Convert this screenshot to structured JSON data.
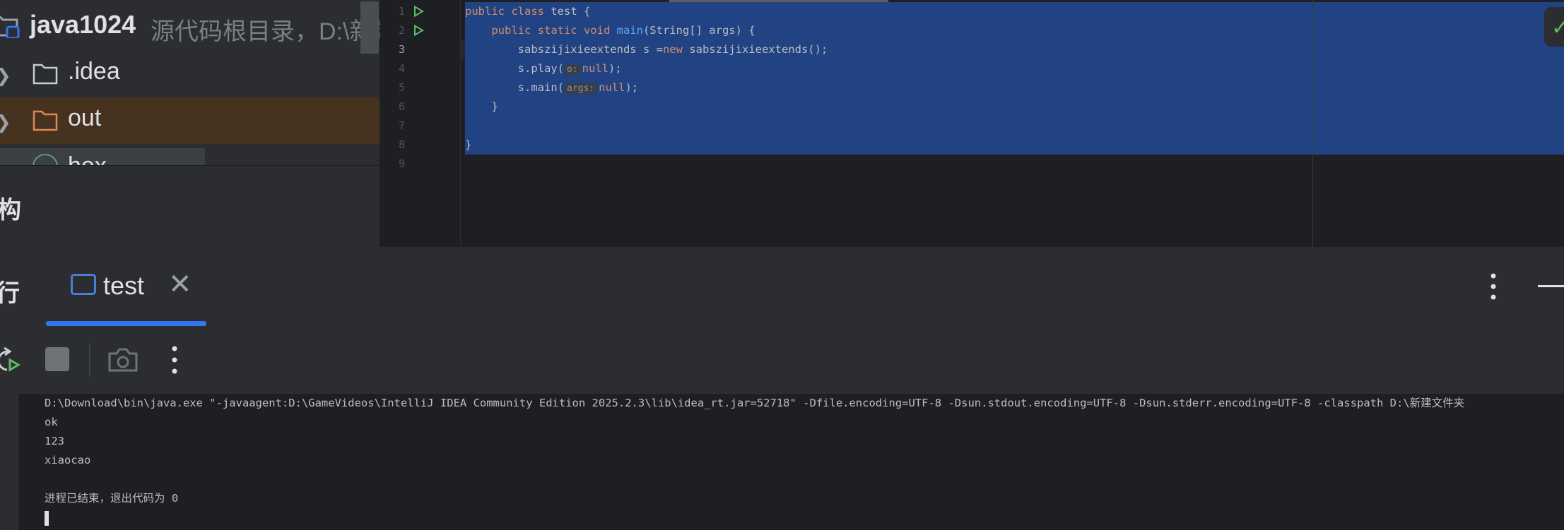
{
  "project": {
    "name": "java1024",
    "path_hint": "源代码根目录，D:\\新建",
    "tree": [
      {
        "label": ".idea",
        "type": "folder"
      },
      {
        "label": "out",
        "type": "folder-excluded"
      },
      {
        "label": "hex",
        "type": "file"
      }
    ]
  },
  "structure": {
    "title": "构"
  },
  "editor": {
    "line_numbers": [
      "1",
      "2",
      "3",
      "4",
      "5",
      "6",
      "7",
      "8",
      "9"
    ],
    "current_line": "3",
    "code": {
      "l1_kw": "public class ",
      "l1_rest": "test {",
      "l2_indent": "    ",
      "l2_kw": "public static void ",
      "l2_fn": "main",
      "l2_rest": "(String[] args) {",
      "l3_a": "        sabszijixieextends s =",
      "l3_kw": "new",
      "l3_b": " sabszijixieextends();",
      "l4_a": "        s.play(",
      "l4_hint": "o:",
      "l4_kw": "null",
      "l4_b": ");",
      "l5_a": "        s.main(",
      "l5_hint": "args:",
      "l5_kw": "null",
      "l5_b": ");",
      "l6": "    }",
      "l7": "",
      "l8": "}",
      "l9": ""
    },
    "inspection_icon": "checkmark-icon"
  },
  "run": {
    "title": "行",
    "tab_label": "test",
    "tab_close": "✕",
    "console": [
      "D:\\Download\\bin\\java.exe \"-javaagent:D:\\GameVideos\\IntelliJ IDEA Community Edition 2025.2.3\\lib\\idea_rt.jar=52718\" -Dfile.encoding=UTF-8 -Dsun.stdout.encoding=UTF-8 -Dsun.stderr.encoding=UTF-8 -classpath D:\\新建文件夹",
      "ok",
      "123",
      "xiaocao",
      "",
      "进程已结束，退出代码为 0"
    ]
  },
  "colors": {
    "accent": "#3574f0",
    "selection": "#214283",
    "keyword": "#cf8e6d",
    "function": "#56a8f5",
    "run_green": "#5fb865"
  }
}
